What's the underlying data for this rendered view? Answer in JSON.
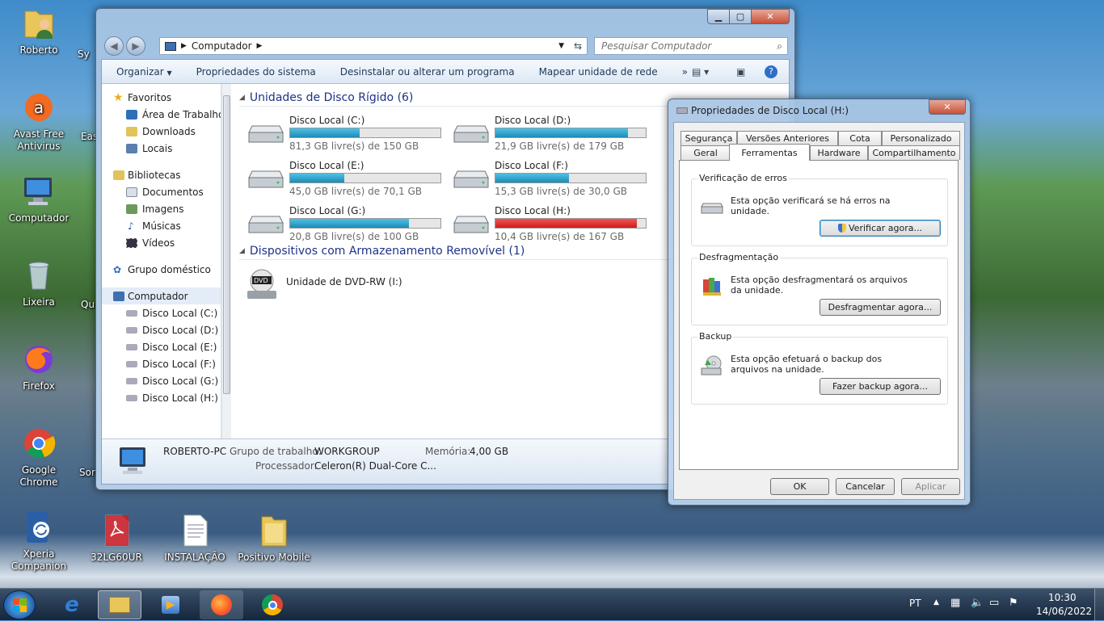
{
  "desktop": {
    "icons": [
      {
        "label": "Roberto",
        "icon": "user-folder-icon"
      },
      {
        "label": "Avast Free Antivirus",
        "icon": "avast-icon"
      },
      {
        "label": "Computador",
        "icon": "computer-icon"
      },
      {
        "label": "Lixeira",
        "icon": "recycle-bin-icon"
      },
      {
        "label": "Firefox",
        "icon": "firefox-icon"
      },
      {
        "label": "Google Chrome",
        "icon": "chrome-icon"
      },
      {
        "label": "Xperia Companion",
        "icon": "xperia-icon"
      },
      {
        "label": "32LG60UR",
        "icon": "pdf-icon"
      },
      {
        "label": "INSTALAÇÃO",
        "icon": "text-file-icon"
      },
      {
        "label": "Positivo Mobile",
        "icon": "folder-icon"
      }
    ],
    "partial_labels": [
      "Sy",
      "Eas",
      "Qu",
      "Sor"
    ]
  },
  "explorer": {
    "address": "Computador",
    "search_placeholder": "Pesquisar Computador",
    "toolbar": {
      "organize": "Organizar",
      "system_props": "Propriedades do sistema",
      "uninstall": "Desinstalar ou alterar um programa",
      "map_drive": "Mapear unidade de rede",
      "more": "»"
    },
    "nav": {
      "favorites": "Favoritos",
      "desktop": "Área de Trabalho",
      "downloads": "Downloads",
      "places": "Locais",
      "libraries": "Bibliotecas",
      "documents": "Documentos",
      "images": "Imagens",
      "music": "Músicas",
      "videos": "Vídeos",
      "homegroup": "Grupo doméstico",
      "computer": "Computador",
      "drives": [
        "Disco Local (C:)",
        "Disco Local (D:)",
        "Disco Local (E:)",
        "Disco Local (F:)",
        "Disco Local (G:)",
        "Disco Local (H:)"
      ]
    },
    "groups": {
      "hard_disks": "Unidades de Disco Rígido (6)",
      "removable": "Dispositivos com Armazenamento Removível (1)"
    },
    "drives": [
      {
        "name": "Disco Local (C:)",
        "free": "81,3 GB livre(s) de 150 GB",
        "used_fraction": 0.46,
        "color": "#2aa1cf"
      },
      {
        "name": "Disco Local (D:)",
        "free": "21,9 GB livre(s) de 179 GB",
        "used_fraction": 0.88,
        "color": "#2aa1cf"
      },
      {
        "name": "Disco Local (E:)",
        "free": "45,0 GB livre(s) de 70,1 GB",
        "used_fraction": 0.36,
        "color": "#2aa1cf"
      },
      {
        "name": "Disco Local (F:)",
        "free": "15,3 GB livre(s) de 30,0 GB",
        "used_fraction": 0.49,
        "color": "#2aa1cf"
      },
      {
        "name": "Disco Local (G:)",
        "free": "20,8 GB livre(s) de 100 GB",
        "used_fraction": 0.79,
        "color": "#2aa1cf"
      },
      {
        "name": "Disco Local (H:)",
        "free": "10,4 GB livre(s) de 167 GB",
        "used_fraction": 0.94,
        "color": "#d92020"
      }
    ],
    "dvd": {
      "name": "Unidade de DVD-RW (I:)",
      "badge": "DVD"
    },
    "details": {
      "pc_name": "ROBERTO-PC",
      "workgroup_label": "Grupo de trabalho:",
      "workgroup_value": "WORKGROUP",
      "memory_label": "Memória:",
      "memory_value": "4,00 GB",
      "cpu_label": "Processador:",
      "cpu_value": "Celeron(R) Dual-Core C..."
    }
  },
  "dialog": {
    "title": "Propriedades de Disco Local (H:)",
    "tabs_row1": [
      "Segurança",
      "Versões Anteriores",
      "Cota",
      "Personalizado"
    ],
    "tabs_row2": [
      "Geral",
      "Ferramentas",
      "Hardware",
      "Compartilhamento"
    ],
    "active_tab": "Ferramentas",
    "error_check": {
      "legend": "Verificação de erros",
      "text": "Esta opção verificará se há erros na unidade.",
      "button": "Verificar agora..."
    },
    "defrag": {
      "legend": "Desfragmentação",
      "text": "Esta opção desfragmentará os arquivos da unidade.",
      "button": "Desfragmentar agora..."
    },
    "backup": {
      "legend": "Backup",
      "text": "Esta opção efetuará o backup dos arquivos na unidade.",
      "button": "Fazer backup agora..."
    },
    "ok": "OK",
    "cancel": "Cancelar",
    "apply": "Aplicar"
  },
  "taskbar": {
    "language": "PT",
    "time": "10:30",
    "date": "14/06/2022"
  }
}
